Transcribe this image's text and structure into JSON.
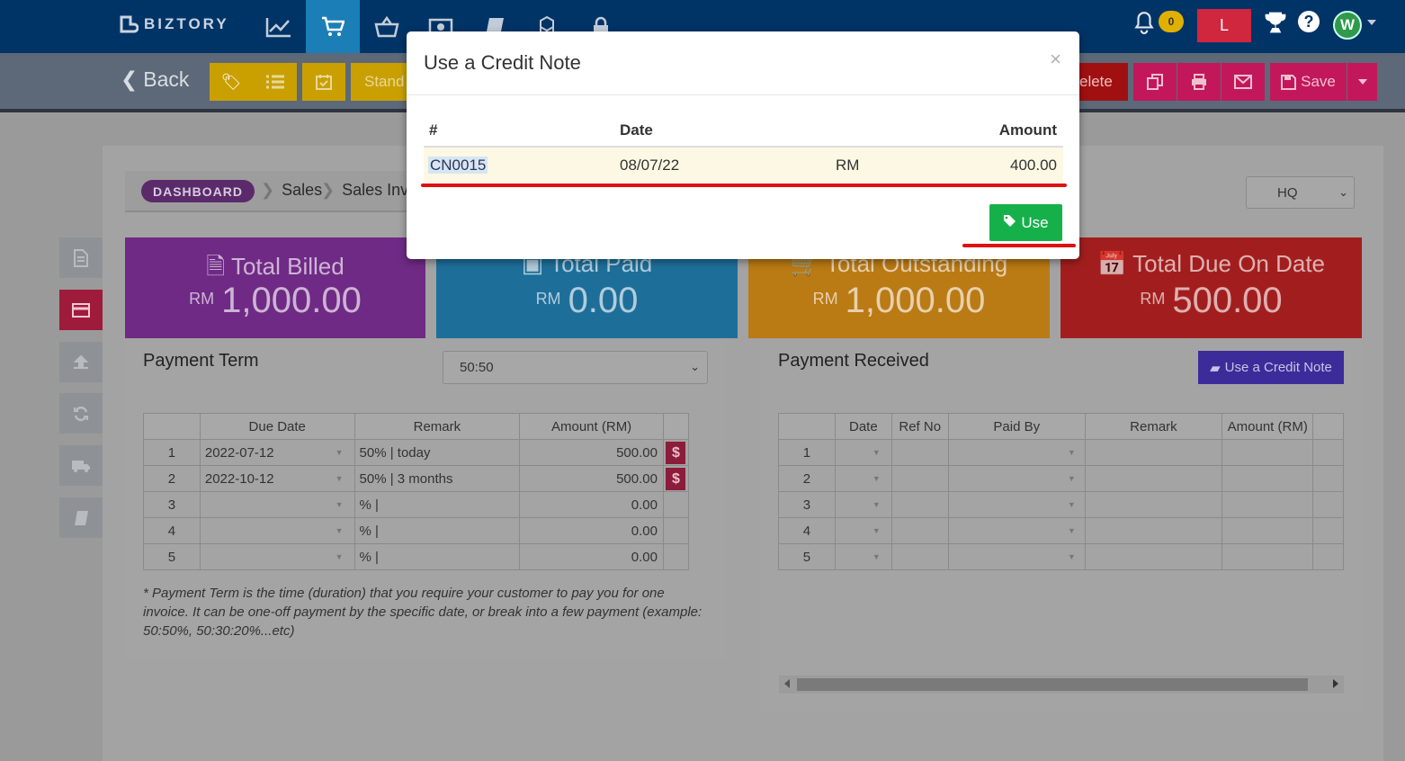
{
  "brand": "BIZTORY",
  "nav_icons": [
    "chart-line-icon",
    "cart-icon",
    "basket-icon",
    "money-icon",
    "book-icon",
    "cubes-icon",
    "lock-icon"
  ],
  "notifications": {
    "count": "0"
  },
  "user_button": "L",
  "avatar": "W",
  "toolbar": {
    "back": "Back",
    "standard_label": "Stand",
    "delete_label": "elete",
    "save": "Save"
  },
  "breadcrumb": {
    "dashboard": "DASHBOARD",
    "sales": "Sales",
    "sales_invoice": "Sales Invo"
  },
  "branch_select": "HQ",
  "cards": [
    {
      "title": "Total Billed",
      "currency": "RM",
      "value": "1,000.00",
      "color": "#6f2a85"
    },
    {
      "title": "Total Paid",
      "currency": "RM",
      "value": "0.00",
      "color": "#1d6f9a"
    },
    {
      "title": "Total Outstanding",
      "currency": "RM",
      "value": "1,000.00",
      "color": "#ba7a14"
    },
    {
      "title": "Total Due On Date",
      "currency": "RM",
      "value": "500.00",
      "color": "#a21e1e"
    }
  ],
  "payment_term": {
    "title": "Payment Term",
    "select": "50:50",
    "headers": [
      "Due Date",
      "Remark",
      "Amount (RM)"
    ],
    "rows": [
      {
        "n": "1",
        "date": "2022-07-12",
        "remark": "50% |  today",
        "amount": "500.00",
        "dollar": "$"
      },
      {
        "n": "2",
        "date": "2022-10-12",
        "remark": "50% | 3 months",
        "amount": "500.00",
        "dollar": "$"
      },
      {
        "n": "3",
        "date": "",
        "remark": "% |",
        "amount": "0.00",
        "dollar": ""
      },
      {
        "n": "4",
        "date": "",
        "remark": "% |",
        "amount": "0.00",
        "dollar": ""
      },
      {
        "n": "5",
        "date": "",
        "remark": "% |",
        "amount": "0.00",
        "dollar": ""
      }
    ],
    "note": "* Payment Term is the time (duration) that you require your customer to pay you for one invoice. It can be one-off payment by the specific date, or break into a few payment (example: 50:50%, 50:30:20%...etc)"
  },
  "payment_received": {
    "title": "Payment Received",
    "use_credit_note": "Use a Credit Note",
    "headers": [
      "Date",
      "Ref No",
      "Paid By",
      "Remark",
      "Amount (RM)"
    ],
    "rows": [
      "1",
      "2",
      "3",
      "4",
      "5"
    ]
  },
  "modal": {
    "title": "Use a Credit Note",
    "close": "×",
    "headers": {
      "num": "#",
      "date": "Date",
      "amount": "Amount"
    },
    "row": {
      "num": "CN0015",
      "date": "08/07/22",
      "currency": "RM",
      "amount": "400.00"
    },
    "use_button": "Use"
  },
  "colors": {
    "navbar": "#013466",
    "active_nav": "#1c7eb6",
    "use_green": "#16b04a",
    "highlight_red": "#e01010"
  }
}
